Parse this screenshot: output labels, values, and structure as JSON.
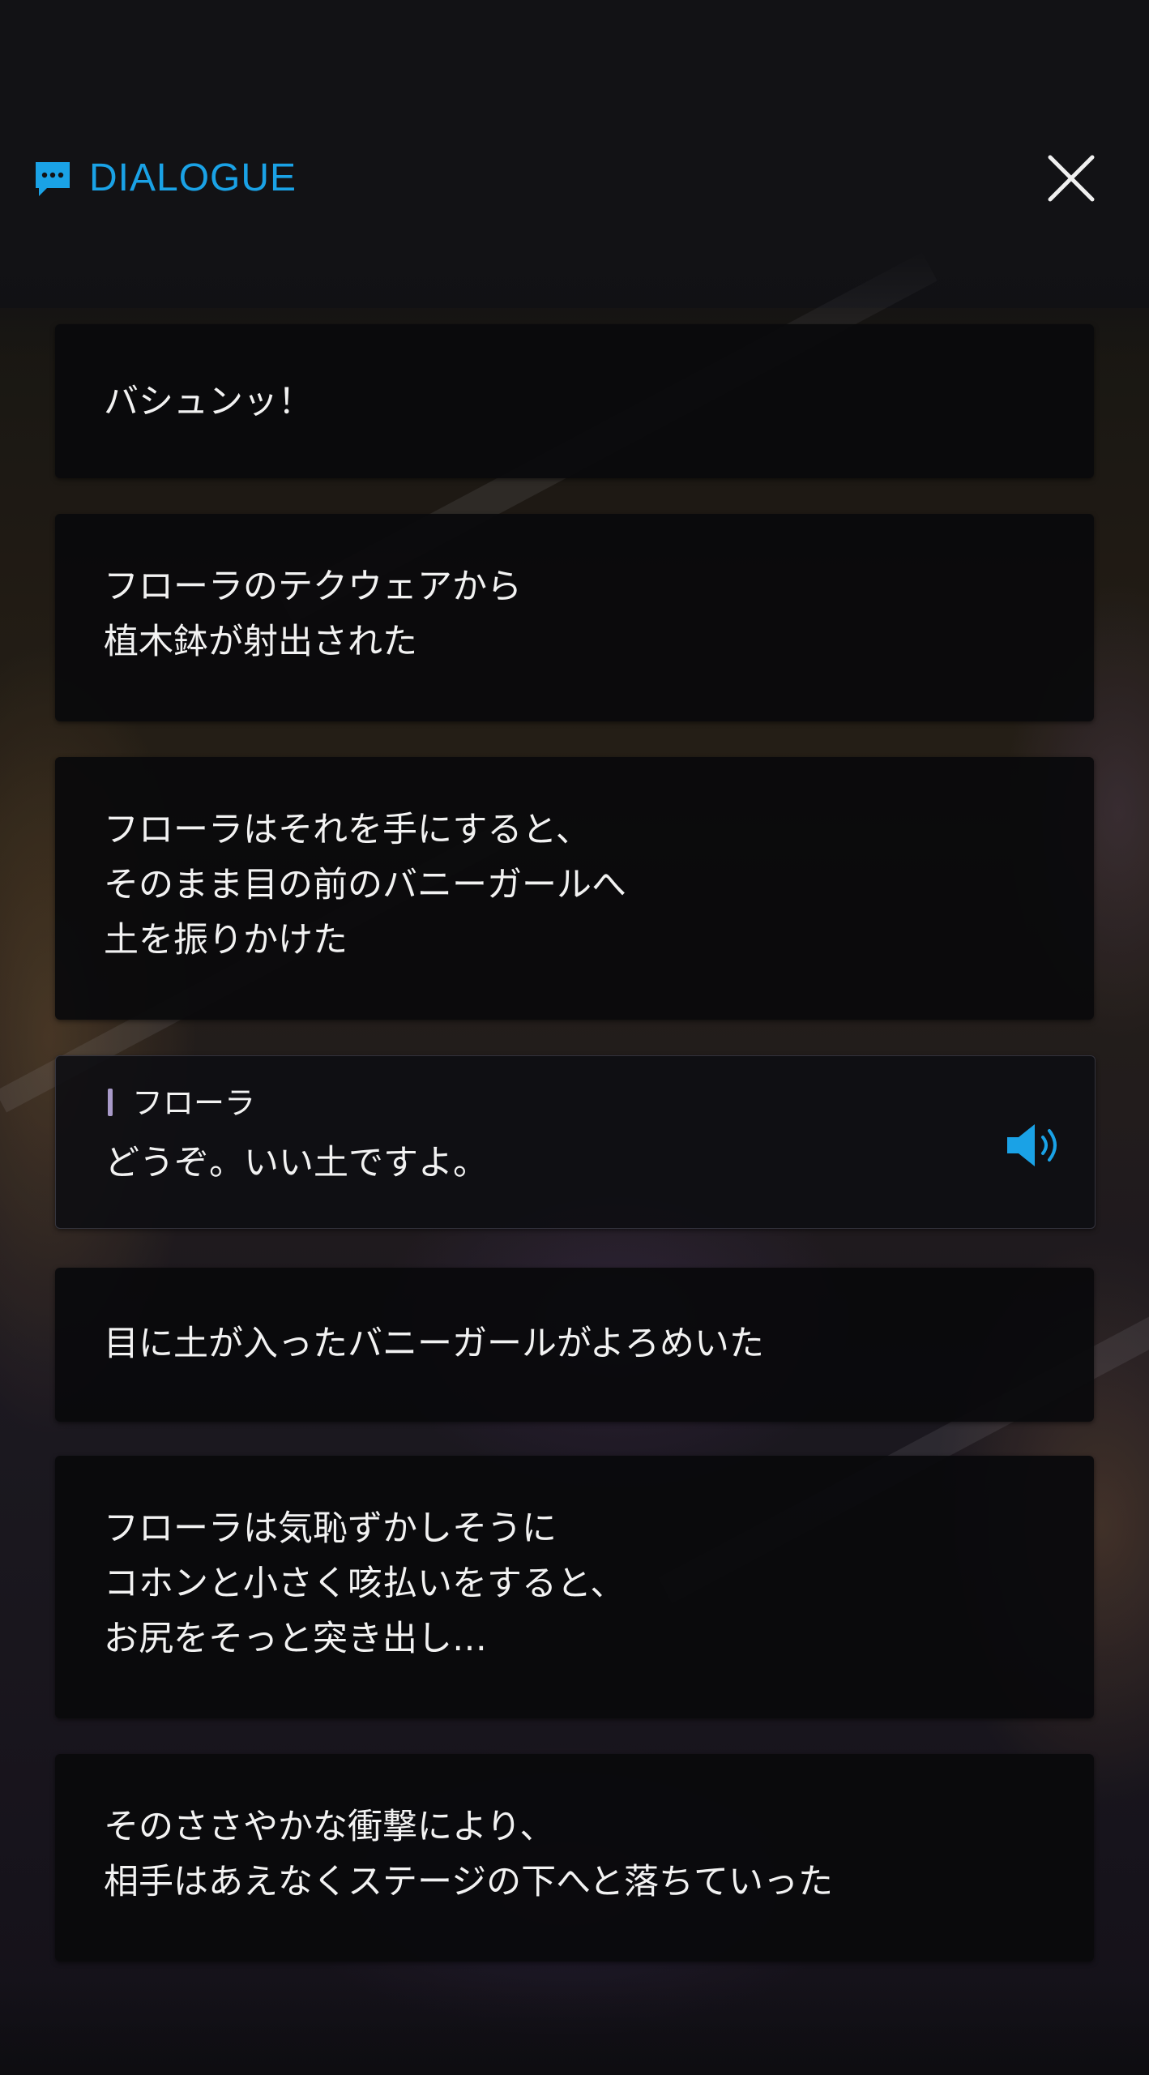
{
  "header": {
    "title": "DIALOGUE",
    "icon": "chat-bubble-icon",
    "close_icon": "close-icon"
  },
  "accent_color": "#1aa2e6",
  "dialogue": [
    {
      "lines": [
        "バシュンッ！"
      ]
    },
    {
      "lines": [
        "フローラのテクウェアから",
        "植木鉢が射出された"
      ]
    },
    {
      "lines": [
        "フローラはそれを手にすると、",
        "そのまま目の前のバニーガールへ",
        "土を振りかけた"
      ]
    },
    {
      "speaker": "フローラ",
      "lines": [
        "どうぞ。いい土ですよ。"
      ],
      "voice_icon": "speaker-volume-icon"
    },
    {
      "lines": [
        "目に土が入ったバニーガールがよろめいた"
      ]
    },
    {
      "lines": [
        "フローラは気恥ずかしそうに",
        "コホンと小さく咳払いをすると、",
        "お尻をそっと突き出し…"
      ]
    },
    {
      "lines": [
        "そのささやかな衝撃により、",
        "相手はあえなくステージの下へと落ちていった"
      ]
    }
  ]
}
